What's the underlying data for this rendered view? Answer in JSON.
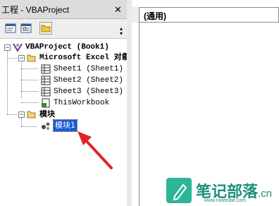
{
  "window": {
    "title": "工程 - VBAProject",
    "close_label": "✕"
  },
  "toolbar": {
    "buttons": [
      {
        "name": "view-code-icon"
      },
      {
        "name": "view-object-icon"
      },
      {
        "name": "toggle-folders-icon"
      }
    ]
  },
  "tree": {
    "project": "VBAProject (Book1)",
    "folder_objects": "Microsoft Excel 对象",
    "sheet1": "Sheet1 (Sheet1)",
    "sheet2": "Sheet2 (Sheet2)",
    "sheet3": "Sheet3 (Sheet3)",
    "workbook": "ThisWorkbook",
    "folder_modules": "模块",
    "module1": "模块1"
  },
  "code": {
    "object_combo": "(通用)"
  },
  "watermark": {
    "text": "笔记部落",
    "suffix": ".cn",
    "url": "www.notetribe.com"
  },
  "colors": {
    "selection": "#1a5bd6",
    "arrow": "#e02424",
    "watermark": "#2db59a"
  }
}
